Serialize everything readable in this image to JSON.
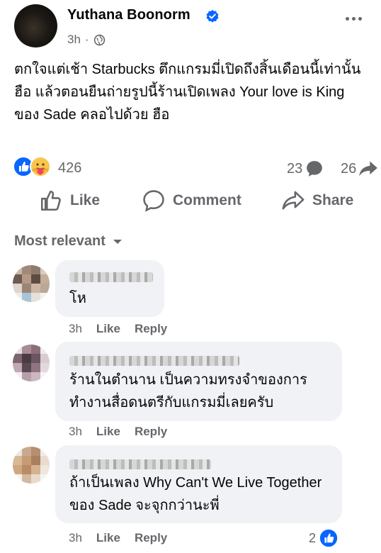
{
  "post": {
    "author": "Yuthana Boonorm",
    "time": "3h",
    "text": "ตกใจแต่เช้า Starbucks ตึกแกรมมี่เปิดถึงสิ้นเดือนนี้เท่านั้น ฮือ แล้วตอนยืนถ่ายรูปนี้ร้านเปิดเพลง Your love is King ของ Sade คลอไปด้วย ฮือ",
    "reaction_count": "426",
    "comment_count": "23",
    "share_count": "26"
  },
  "actions": {
    "like": "Like",
    "comment": "Comment",
    "share": "Share"
  },
  "comments_header": {
    "sort": "Most relevant"
  },
  "comments": [
    {
      "text": "โห",
      "time": "3h",
      "like": "Like",
      "reply": "Reply"
    },
    {
      "text": "ร้านในตำนาน เป็นความทรงจำของการทำงานสื่อดนตรีกับแกรมมี่เลยครับ",
      "time": "3h",
      "like": "Like",
      "reply": "Reply"
    },
    {
      "text": "ถ้าเป็นเพลง Why Can't We Live Together ของ Sade จะจุกกว่านะพี่",
      "time": "3h",
      "like": "Like",
      "reply": "Reply",
      "likes": "2"
    }
  ],
  "colors": {
    "accent": "#0866ff",
    "muted": "#65676b",
    "bubble": "#f0f2f5"
  },
  "icons": [
    "verified-badge-icon",
    "globe-icon",
    "more-options-icon",
    "like-reaction-icon",
    "care-reaction-icon",
    "comment-bubble-icon",
    "share-arrow-icon",
    "thumb-up-icon",
    "comment-icon",
    "share-icon",
    "caret-down-icon"
  ]
}
